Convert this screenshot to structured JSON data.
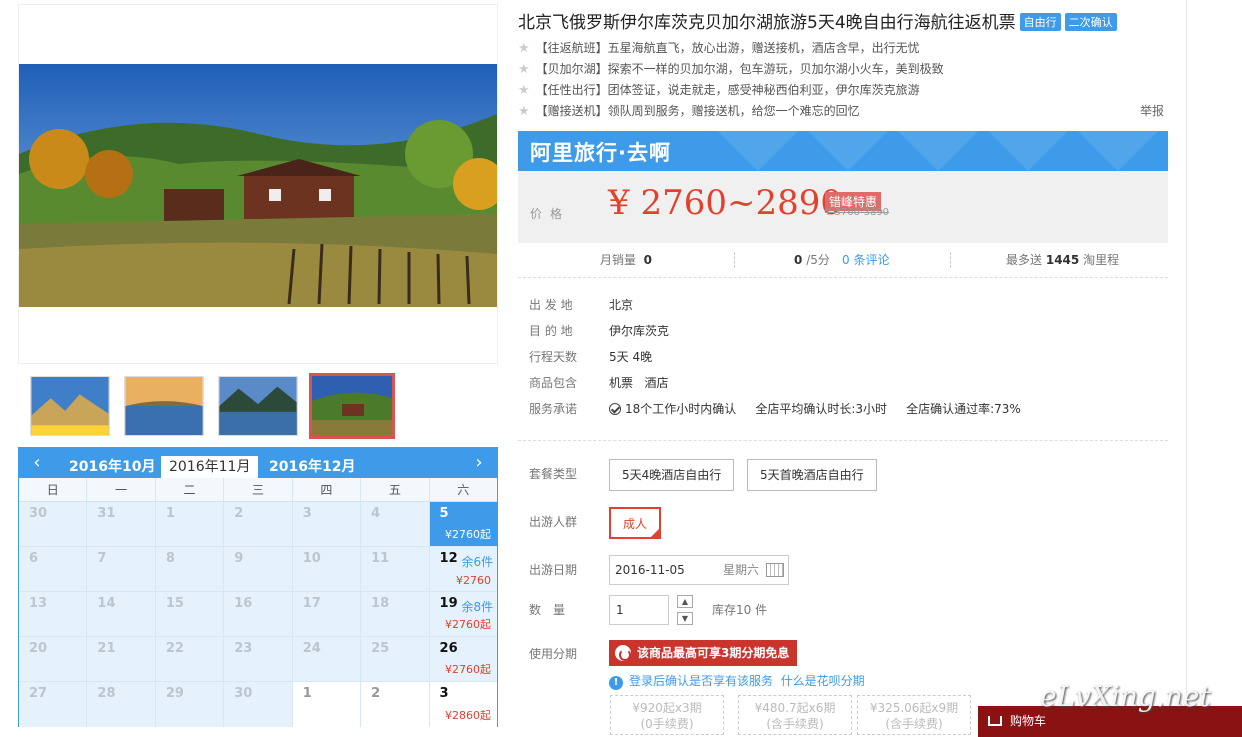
{
  "product": {
    "title": "北京飞俄罗斯伊尔库茨克贝加尔湖旅游5天4晚自由行海航往返机票",
    "badges": [
      "自由行",
      "二次确认"
    ],
    "features": [
      "【往返航班】五星海航直飞，放心出游，赠送接机，酒店含早，出行无忧",
      "【贝加尔湖】探索不一样的贝加尔湖，包车游玩，贝加尔湖小火车，美到极致",
      "【任性出行】团体签证，说走就走，感受神秘西伯利亚，伊尔库茨克旅游",
      "【赠接送机】领队周到服务，赠接送机，给您一个难忘的回忆"
    ],
    "report_label": "举报"
  },
  "price": {
    "brand": "阿里旅行·去啊",
    "label": "价格",
    "value": "¥ 2760~2890",
    "promo": "错峰特惠",
    "original": "¥ 3760-3890"
  },
  "stats": {
    "monthly_label": "月销量",
    "monthly_value": "0",
    "score_value": "0",
    "score_suffix": "/5分",
    "reviews": "0 条评论",
    "points_prefix": "最多送",
    "points_value": "1445",
    "points_suffix": "淘里程"
  },
  "info": [
    {
      "key": "出 发 地",
      "value": "北京"
    },
    {
      "key": "目 的 地",
      "value": "伊尔库茨克"
    },
    {
      "key": "行程天数",
      "value": "5天 4晚"
    },
    {
      "key": "商品包含",
      "value": "机票   酒店"
    },
    {
      "key": "服务承诺",
      "value": "18个工作小时内确认     全店平均确认时长:3小时     全店确认通过率:73%"
    }
  ],
  "options": {
    "package_label": "套餐类型",
    "packages": [
      "5天4晚酒店自由行",
      "5天首晚酒店自由行"
    ],
    "traveler_label": "出游人群",
    "traveler": "成人",
    "date_label": "出游日期",
    "date_value": "2016-11-05",
    "weekday": "星期六",
    "qty_label": "数　量",
    "qty_value": "1",
    "stock": "库存10 件",
    "installment_label": "使用分期",
    "installment_banner": "该商品最高可享3期分期免息",
    "huabei_note": "登录后确认是否享有该服务",
    "huabei_link": "什么是花呗分期",
    "plans": [
      {
        "line1": "¥920起x3期",
        "line2": "(0手续费)"
      },
      {
        "line1": "¥480.7起x6期",
        "line2": "(含手续费)"
      },
      {
        "line1": "¥325.06起x9期",
        "line2": "(含手续费)"
      }
    ],
    "cart_label": "购物车"
  },
  "calendar": {
    "months": [
      "2016年10月",
      "2016年11月",
      "2016年12月"
    ],
    "active_month": 1,
    "weekdays": [
      "日",
      "一",
      "二",
      "三",
      "四",
      "五",
      "六"
    ],
    "rows": [
      [
        {
          "d": "30"
        },
        {
          "d": "31"
        },
        {
          "d": "1"
        },
        {
          "d": "2"
        },
        {
          "d": "3"
        },
        {
          "d": "4"
        },
        {
          "d": "5",
          "price": "¥2760起",
          "sel": true
        }
      ],
      [
        {
          "d": "6"
        },
        {
          "d": "7"
        },
        {
          "d": "8"
        },
        {
          "d": "9"
        },
        {
          "d": "10"
        },
        {
          "d": "11"
        },
        {
          "d": "12",
          "rem": "余6件",
          "price": "¥2760"
        }
      ],
      [
        {
          "d": "13"
        },
        {
          "d": "14"
        },
        {
          "d": "15"
        },
        {
          "d": "16"
        },
        {
          "d": "17"
        },
        {
          "d": "18"
        },
        {
          "d": "19",
          "rem": "余8件",
          "price": "¥2760起"
        }
      ],
      [
        {
          "d": "20"
        },
        {
          "d": "21"
        },
        {
          "d": "22"
        },
        {
          "d": "23"
        },
        {
          "d": "24"
        },
        {
          "d": "25"
        },
        {
          "d": "26",
          "price": "¥2760起"
        }
      ],
      [
        {
          "d": "27"
        },
        {
          "d": "28"
        },
        {
          "d": "29"
        },
        {
          "d": "30"
        },
        {
          "d": "1",
          "white": true,
          "dark": true
        },
        {
          "d": "2",
          "white": true,
          "dark": true
        },
        {
          "d": "3",
          "price": "¥2860起",
          "white": true
        }
      ]
    ]
  },
  "watermark": "eLvXing.net",
  "colors": {
    "accent": "#3d9be9",
    "price": "#e0422d",
    "installment": "#c9342c"
  }
}
